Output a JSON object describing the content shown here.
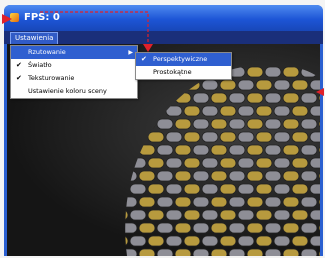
{
  "window": {
    "title": "FPS: 0",
    "app_icon": "app-icon"
  },
  "menubar": {
    "menu_label": "Ustawienia"
  },
  "menu": {
    "items": [
      {
        "label": "Rzutowanie",
        "checked": false,
        "has_submenu": true,
        "highlighted": true
      },
      {
        "label": "Światło",
        "checked": true,
        "has_submenu": false,
        "highlighted": false
      },
      {
        "label": "Teksturowanie",
        "checked": true,
        "has_submenu": false,
        "highlighted": false
      },
      {
        "label": "Ustawienie koloru sceny",
        "checked": false,
        "has_submenu": false,
        "highlighted": false
      }
    ],
    "check_glyph": "✔",
    "submenu_arrow_glyph": "▶"
  },
  "submenu": {
    "items": [
      {
        "label": "Perspektywiczne",
        "checked": true
      },
      {
        "label": "Prostokątne",
        "checked": false
      }
    ]
  },
  "colors": {
    "title_bar": "#1d55d6",
    "menu_highlight": "#2f5fd0",
    "annotation": "#e0202a",
    "pattern_light": "#8e8e96",
    "pattern_gold": "#b79a3e"
  },
  "annotations": [
    "red-arrow-icon",
    "red-arrow-icon",
    "red-arrow-icon"
  ]
}
